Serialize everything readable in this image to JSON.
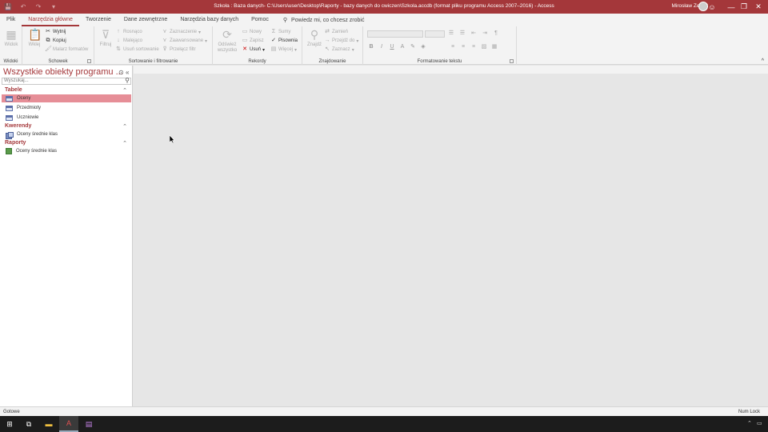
{
  "titlebar": {
    "title": "Szkoła : Baza danych- C:\\Users\\user\\Desktop\\Raporty - bazy danych do cwiczen\\Szkola.accdb (format pliku programu Access 2007–2016)  -  Access",
    "user": "Mirosław Zelent",
    "minimize": "—",
    "restore": "❐",
    "close": "✕",
    "help": "☺"
  },
  "qat": {
    "save": "💾",
    "undo": "↶",
    "redo": "↷",
    "more": "▾"
  },
  "tabs": [
    "Plik",
    "Narzędzia główne",
    "Tworzenie",
    "Dane zewnętrzne",
    "Narzędzia bazy danych",
    "Pomoc"
  ],
  "tell_me": "Powiedz mi, co chcesz zrobić",
  "ribbon": {
    "widoki": {
      "label": "Widoki",
      "btn": "Widok"
    },
    "schowek": {
      "label": "Schowek",
      "paste": "Wklej",
      "cut": "Wytnij",
      "copy": "Kopiuj",
      "painter": "Malarz formatów"
    },
    "sort": {
      "label": "Sortowanie i filtrowanie",
      "filter": "Filtruj",
      "asc": "Rosnąco",
      "desc": "Malejąco",
      "remove_sort": "Usuń sortowanie",
      "selection": "Zaznaczenie",
      "advanced": "Zaawansowane",
      "toggle": "Przełącz filtr"
    },
    "rekordy": {
      "label": "Rekordy",
      "refresh": "Odśwież wszystko",
      "new": "Nowy",
      "save": "Zapisz",
      "delete": "Usuń",
      "totals": "Sumy",
      "spelling": "Pisownia",
      "more": "Więcej"
    },
    "znajdowanie": {
      "label": "Znajdowanie",
      "find": "Znajdź",
      "replace": "Zamień",
      "goto": "Przejdź do",
      "select": "Zaznacz"
    },
    "formatowanie": {
      "label": "Formatowanie tekstu",
      "bold": "B",
      "italic": "I",
      "underline": "U"
    }
  },
  "nav": {
    "title": "Wszystkie obiekty programu ...",
    "search_placeholder": "Wyszukaj...",
    "categories": [
      {
        "name": "Tabele",
        "items": [
          "Oceny",
          "Przedmioty",
          "Uczniowie"
        ]
      },
      {
        "name": "Kwerendy",
        "items": [
          "Oceny średnie klas"
        ]
      },
      {
        "name": "Raporty",
        "items": [
          "Oceny średnie klas"
        ]
      }
    ]
  },
  "status": {
    "left": "Gotowe",
    "right": "Num Lock"
  },
  "colors": {
    "accent": "#a4373a",
    "selected": "#e68e97"
  }
}
